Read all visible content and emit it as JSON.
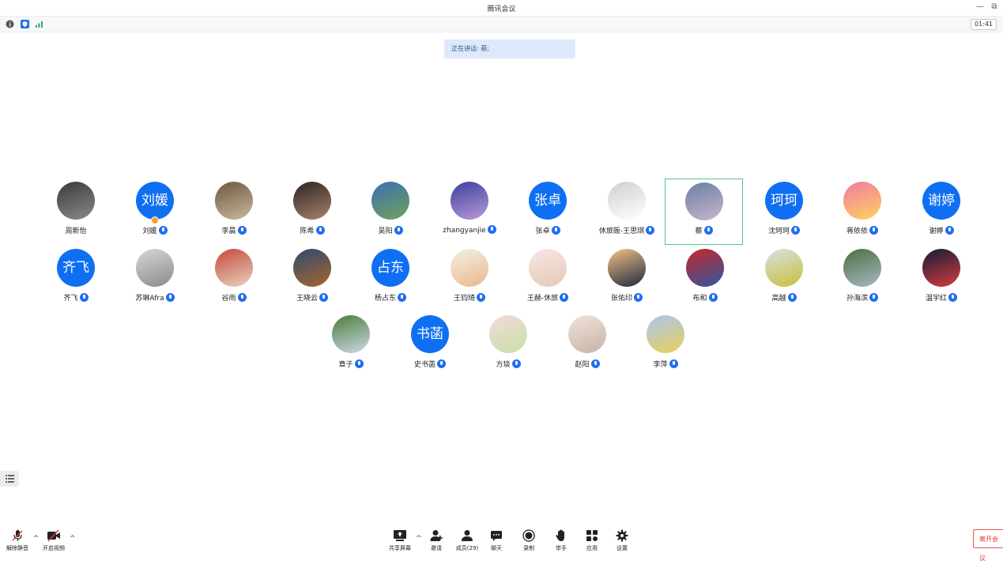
{
  "window": {
    "title": "腾讯会议",
    "minimize_glyph": "—",
    "restore_glyph": "⧉"
  },
  "infobar": {
    "timer": "01:41",
    "icons": [
      "info-icon",
      "shield-icon",
      "signal-icon"
    ]
  },
  "speaking": {
    "text": "正在讲话: 蔡;"
  },
  "participants": [
    {
      "name": "周新怡",
      "avatar_text": "",
      "mic": false
    },
    {
      "name": "刘媛",
      "avatar_text": "刘媛",
      "mic": true
    },
    {
      "name": "李晨",
      "avatar_text": "",
      "mic": true
    },
    {
      "name": "陈希",
      "avatar_text": "",
      "mic": true
    },
    {
      "name": "吴阳",
      "avatar_text": "",
      "mic": true
    },
    {
      "name": "zhangyanjie",
      "avatar_text": "",
      "mic": true
    },
    {
      "name": "张卓",
      "avatar_text": "张卓",
      "mic": true
    },
    {
      "name": "休旅販-王思琪",
      "avatar_text": "",
      "mic": true
    },
    {
      "name": "蔡",
      "avatar_text": "",
      "mic": true
    },
    {
      "name": "沈珂珂",
      "avatar_text": "珂珂",
      "mic": true
    },
    {
      "name": "蒋依依",
      "avatar_text": "",
      "mic": true
    },
    {
      "name": "谢婷",
      "avatar_text": "谢婷",
      "mic": true
    },
    {
      "name": "齐飞",
      "avatar_text": "齐飞",
      "mic": true
    },
    {
      "name": "苏琳Afra",
      "avatar_text": "",
      "mic": true
    },
    {
      "name": "谷雨",
      "avatar_text": "",
      "mic": true
    },
    {
      "name": "王晓云",
      "avatar_text": "",
      "mic": true
    },
    {
      "name": "杨占东",
      "avatar_text": "占东",
      "mic": true
    },
    {
      "name": "王钧琦",
      "avatar_text": "",
      "mic": true
    },
    {
      "name": "王赫-休旅",
      "avatar_text": "",
      "mic": true
    },
    {
      "name": "张佑印",
      "avatar_text": "",
      "mic": true
    },
    {
      "name": "布和",
      "avatar_text": "",
      "mic": true
    },
    {
      "name": "高越",
      "avatar_text": "",
      "mic": true
    },
    {
      "name": "孙海滨",
      "avatar_text": "",
      "mic": true
    },
    {
      "name": "温宇红",
      "avatar_text": "",
      "mic": true
    },
    {
      "name": "章子",
      "avatar_text": "",
      "mic": true
    },
    {
      "name": "史书菡",
      "avatar_text": "书菡",
      "mic": true
    },
    {
      "name": "方琰",
      "avatar_text": "",
      "mic": true
    },
    {
      "name": "赵阳",
      "avatar_text": "",
      "mic": true
    },
    {
      "name": "李萍",
      "avatar_text": "",
      "mic": true
    }
  ],
  "toolbar": {
    "unmute": "解除静音",
    "start_video": "开启视频",
    "share_screen": "共享屏幕",
    "invite": "邀请",
    "members": "成员(29)",
    "chat": "聊天",
    "record": "录制",
    "raise_hand": "举手",
    "apps": "应用",
    "settings": "设置",
    "leave": "离开会议",
    "caret": "^"
  },
  "colors": {
    "accent": "#0f6ff2",
    "active_border": "#4fc97f",
    "leave_red": "#e03b36",
    "speaking_bg": "#dde9fb"
  }
}
